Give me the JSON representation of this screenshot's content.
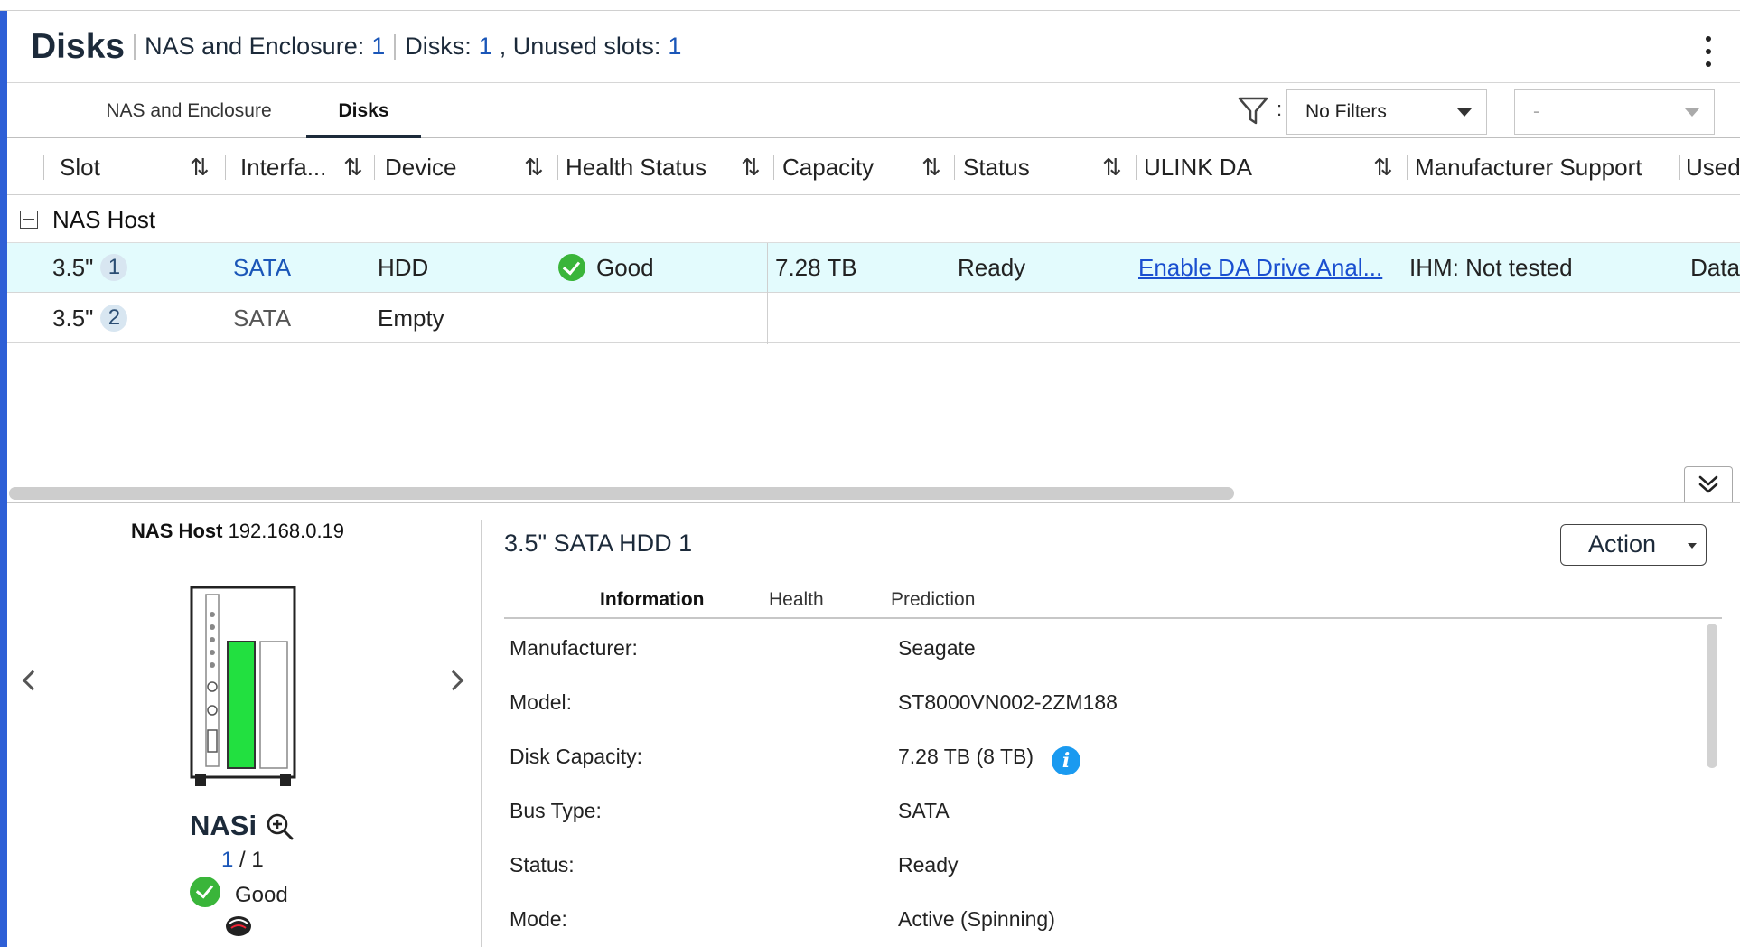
{
  "header": {
    "title": "Disks",
    "nas_enclosure_label": "NAS and Enclosure:",
    "nas_enclosure_count": "1",
    "disks_label": "Disks:",
    "disks_count": "1",
    "unused_label": ", Unused slots:",
    "unused_count": "1"
  },
  "tabs": [
    {
      "label": "NAS and Enclosure",
      "active": false
    },
    {
      "label": "Disks",
      "active": true
    }
  ],
  "filter": {
    "icon": "filter-icon",
    "colon": ":",
    "selected": "No Filters",
    "secondary": "-"
  },
  "columns": [
    "Slot",
    "Interfa...",
    "Device",
    "Health Status",
    "Capacity",
    "Status",
    "ULINK DA",
    "Manufacturer Support",
    "Used"
  ],
  "sort_glyph": "⇅",
  "group": {
    "label": "NAS Host"
  },
  "rows": [
    {
      "slot": "3.5\"",
      "slot_num": "1",
      "interface": "SATA",
      "device": "HDD",
      "health": "Good",
      "capacity": "7.28 TB",
      "status": "Ready",
      "ulink": "Enable DA Drive Anal...",
      "manufacturer": "IHM: Not tested",
      "used": "Data"
    },
    {
      "slot": "3.5\"",
      "slot_num": "2",
      "interface": "SATA",
      "device": "Empty",
      "health": "",
      "capacity": "",
      "status": "",
      "ulink": "",
      "manufacturer": "",
      "used": ""
    }
  ],
  "left_panel": {
    "host_label": "NAS Host",
    "host_ip": "192.168.0.19",
    "nas_name": "NASi",
    "count_current": "1",
    "count_sep": " / ",
    "count_total": "1",
    "health": "Good"
  },
  "detail": {
    "title": "3.5\" SATA HDD 1",
    "action_label": "Action",
    "tabs": [
      "Information",
      "Health",
      "Prediction"
    ],
    "info": [
      {
        "key": "Manufacturer:",
        "value": "Seagate"
      },
      {
        "key": "Model:",
        "value": "ST8000VN002-2ZM188"
      },
      {
        "key": "Disk Capacity:",
        "value": "7.28 TB (8 TB)"
      },
      {
        "key": "Bus Type:",
        "value": "SATA"
      },
      {
        "key": "Status:",
        "value": "Ready"
      },
      {
        "key": "Mode:",
        "value": "Active (Spinning)"
      }
    ]
  },
  "colors": {
    "accent": "#2e5fd6",
    "link": "#1a56b8",
    "selected_row": "#e3fbfd",
    "good": "#3ab53a",
    "disk_green": "#22e040",
    "info_blue": "#1a9af0"
  }
}
